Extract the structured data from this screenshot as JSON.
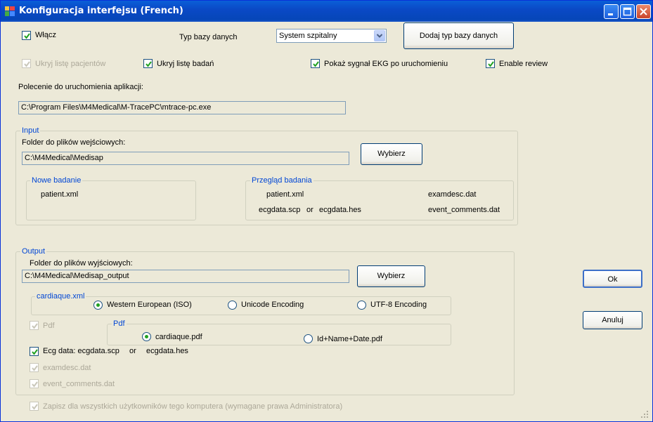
{
  "window": {
    "title": "Konfiguracja interfejsu (French)"
  },
  "top": {
    "enable_label": "Włącz",
    "db_type_label": "Typ bazy danych",
    "db_type_value": "System szpitalny",
    "add_db_type_label": "Dodaj typ bazy danych",
    "hide_patients_label": "Ukryj listę pacjentów",
    "hide_tests_label": "Ukryj listę badań",
    "show_ekg_label": "Pokaż sygnał EKG po uruchomieniu",
    "enable_review_label": "Enable review",
    "command_label": "Polecenie do uruchomienia aplikacji:",
    "command_value": "C:\\Program Files\\M4Medical\\M-TracePC\\mtrace-pc.exe"
  },
  "input": {
    "group_label": "Input",
    "folder_label": "Folder do plików wejściowych:",
    "folder_value": "C:\\M4Medical\\Medisap",
    "browse_label": "Wybierz",
    "new_test": {
      "label": "Nowe badanie",
      "file": "patient.xml"
    },
    "review": {
      "label": "Przegląd badania",
      "patient": "patient.xml",
      "examdesc": "examdesc.dat",
      "ecgscp": "ecgdata.scp",
      "or": "or",
      "ecghes": "ecgdata.hes",
      "comments": "event_comments.dat"
    }
  },
  "output": {
    "group_label": "Output",
    "folder_label": "Folder do plików wyjściowych:",
    "folder_value": "C:\\M4Medical\\Medisap_output",
    "browse_label": "Wybierz",
    "xml_group_label": "cardiaque.xml",
    "enc_western": "Western European (ISO)",
    "enc_unicode": "Unicode Encoding",
    "enc_utf8": "UTF-8 Encoding",
    "pdf_label": "Pdf",
    "pdf_group_label": "Pdf",
    "pdf_name1": "cardiaque.pdf",
    "pdf_name2": "Id+Name+Date.pdf",
    "ecg_data_label": "Ecg data: ecgdata.scp",
    "ecg_or": "or",
    "ecg_hes": "ecgdata.hes",
    "examdesc_label": "examdesc.dat",
    "comments_label": "event_comments.dat"
  },
  "bottom": {
    "save_all_users_label": "Zapisz dla wszystkich użytkowników tego komputera (wymagane prawa Administratora)"
  },
  "buttons": {
    "ok": "Ok",
    "cancel": "Anuluj"
  }
}
